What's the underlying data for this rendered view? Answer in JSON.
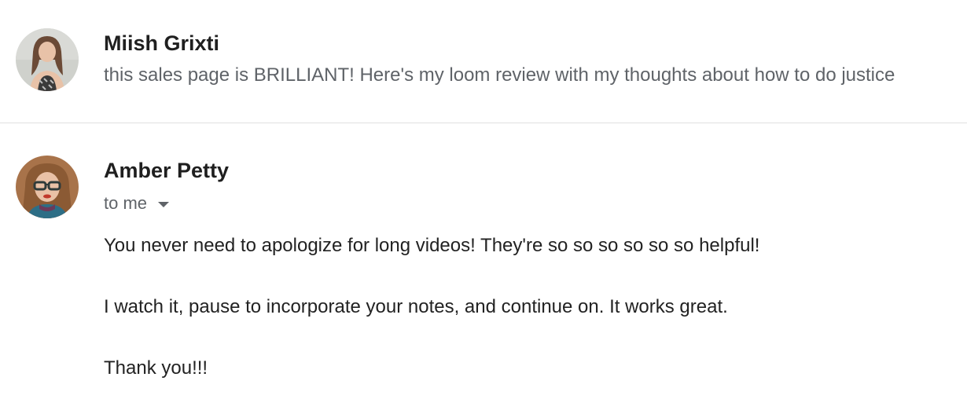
{
  "thread": {
    "messages": [
      {
        "state": "collapsed",
        "sender": "Miish Grixti",
        "snippet": "this sales page is BRILLIANT! Here's my loom review with my thoughts about how to do justice",
        "avatar": "sender-photo-avatar"
      },
      {
        "state": "expanded",
        "sender": "Amber Petty",
        "recipients_label": "to me",
        "recipients_icon": "caret-down-icon",
        "avatar": "sender-photo-avatar",
        "body": [
          "You never need to apologize for long videos! They're so so so so so so helpful!",
          "I watch it, pause to incorporate your notes, and continue on. It works great.",
          "Thank you!!!"
        ]
      }
    ]
  },
  "colors": {
    "sender_name": "#1f1f1f",
    "snippet": "#5f6368",
    "body_text": "#222222",
    "divider": "#e0e0e0"
  }
}
